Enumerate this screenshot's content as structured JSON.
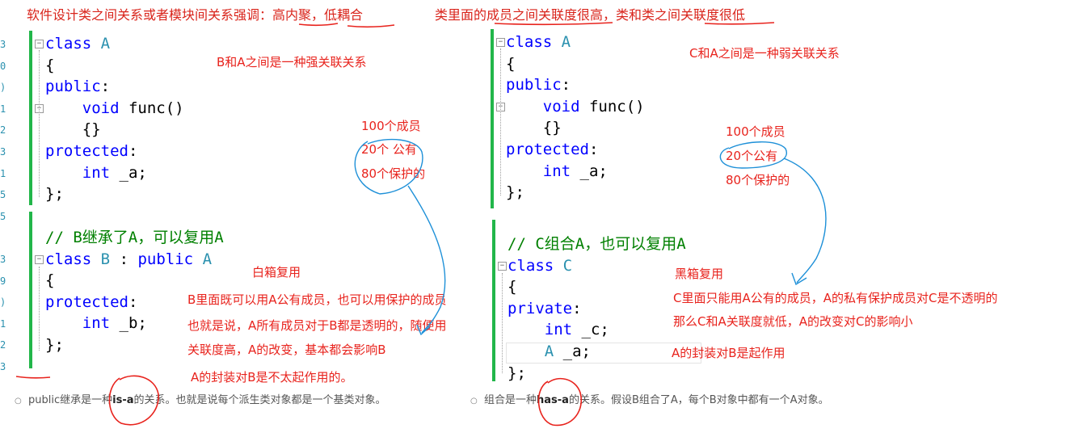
{
  "top_notes": {
    "left": "软件设计类之间关系或者模块间关系强调：高内聚，低耦合",
    "right": "类里面的成员之间关联度很高，类和类之间关联度很低"
  },
  "left_panel": {
    "class_a": {
      "line1_kw": "class",
      "line1_name": "A",
      "line2": "{",
      "line3_kw": "public",
      "line3_colon": ":",
      "line4_kw": "void",
      "line4_rest": "func()",
      "line5": "{}",
      "line6_kw": "protected",
      "line6_colon": ":",
      "line7_kw": "int",
      "line7_rest": "_a;",
      "line8": "};"
    },
    "class_b": {
      "comment": "// B继承了A，可以复用A",
      "line1_kw": "class",
      "line1_name": "B",
      "line1_sep": ":",
      "line1_kw2": "public",
      "line1_base": "A",
      "line2": "{",
      "line3_kw": "protected",
      "line3_colon": ":",
      "line4_kw": "int",
      "line4_rest": "_b;",
      "line5": "};"
    },
    "notes": {
      "relation": "B和A之间是一种强关联关系",
      "members_100": "100个成员",
      "public_20": "20个 公有",
      "protected_80": "80个保护的",
      "white_box": "白箱复用",
      "desc1": "B里面既可以用A公有成员，也可以用保护的成员",
      "desc2": "也就是说，A所有成员对于B都是透明的，随便用",
      "desc3": "关联度高，A的改变，基本都会影响B",
      "desc4": "A的封装对B是不太起作用的。"
    },
    "bullet": {
      "pre": "public继承是一种",
      "bold": "is-a",
      "post": "的关系。也就是说每个派生类对象都是一个基类对象。"
    }
  },
  "right_panel": {
    "class_a": {
      "line1_kw": "class",
      "line1_name": "A",
      "line2": "{",
      "line3_kw": "public",
      "line3_colon": ":",
      "line4_kw": "void",
      "line4_rest": "func()",
      "line5": "{}",
      "line6_kw": "protected",
      "line6_colon": ":",
      "line7_kw": "int",
      "line7_rest": "_a;",
      "line8": "};"
    },
    "class_c": {
      "comment": "// C组合A，也可以复用A",
      "line1_kw": "class",
      "line1_name": "C",
      "line2": "{",
      "line3_kw": "private",
      "line3_colon": ":",
      "line4_kw": "int",
      "line4_rest": "_c;",
      "line5_type": "A",
      "line5_rest": "_a;",
      "line6": "};"
    },
    "notes": {
      "relation": "C和A之间是一种弱关联关系",
      "members_100": "100个成员",
      "public_20": "20个公有",
      "protected_80": "80个保护的",
      "black_box": "黑箱复用",
      "desc1": "C里面只能用A公有的成员，A的私有保护成员对C是不透明的",
      "desc2": "那么C和A关联度就低，A的改变对C的影响小",
      "desc3": "A的封装对B是起作用"
    },
    "bullet": {
      "pre": "组合是一种",
      "bold": "has-a",
      "post": "的关系。假设B组合了A，每个B对象中都有一个A对象。"
    }
  },
  "colors": {
    "keyword": "#0000ff",
    "class_name": "#2b91af",
    "comment": "#008000",
    "annotation": "#e8231d",
    "annotation_blue": "#1e90d8",
    "bar": "#22b64a"
  }
}
